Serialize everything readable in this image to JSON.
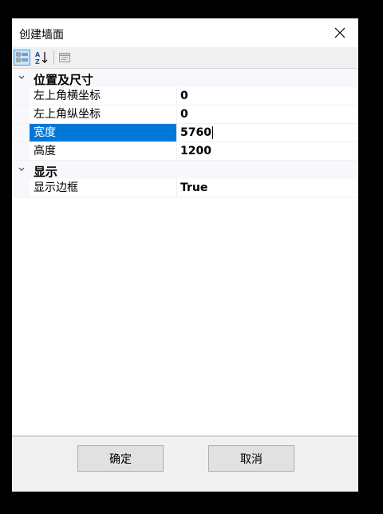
{
  "window": {
    "title": "创建墙面"
  },
  "toolbar": {
    "categorized_icon": "categorized-view-icon",
    "alphabetical_icon": "alphabetical-sort-icon",
    "property_pages_icon": "property-pages-icon"
  },
  "grid": {
    "categories": [
      {
        "label": "位置及尺寸",
        "properties": [
          {
            "name": "左上角横坐标",
            "value": "0"
          },
          {
            "name": "左上角纵坐标",
            "value": "0"
          },
          {
            "name": "宽度",
            "value": "5760",
            "selected": true
          },
          {
            "name": "高度",
            "value": "1200"
          }
        ]
      },
      {
        "label": "显示",
        "properties": [
          {
            "name": "显示边框",
            "value": "True"
          }
        ]
      }
    ]
  },
  "buttons": {
    "ok": "确定",
    "cancel": "取消"
  },
  "colors": {
    "selection": "#0078d7",
    "category_bg": "#f7f8fb",
    "dialog_bg": "#f0f0f0"
  }
}
